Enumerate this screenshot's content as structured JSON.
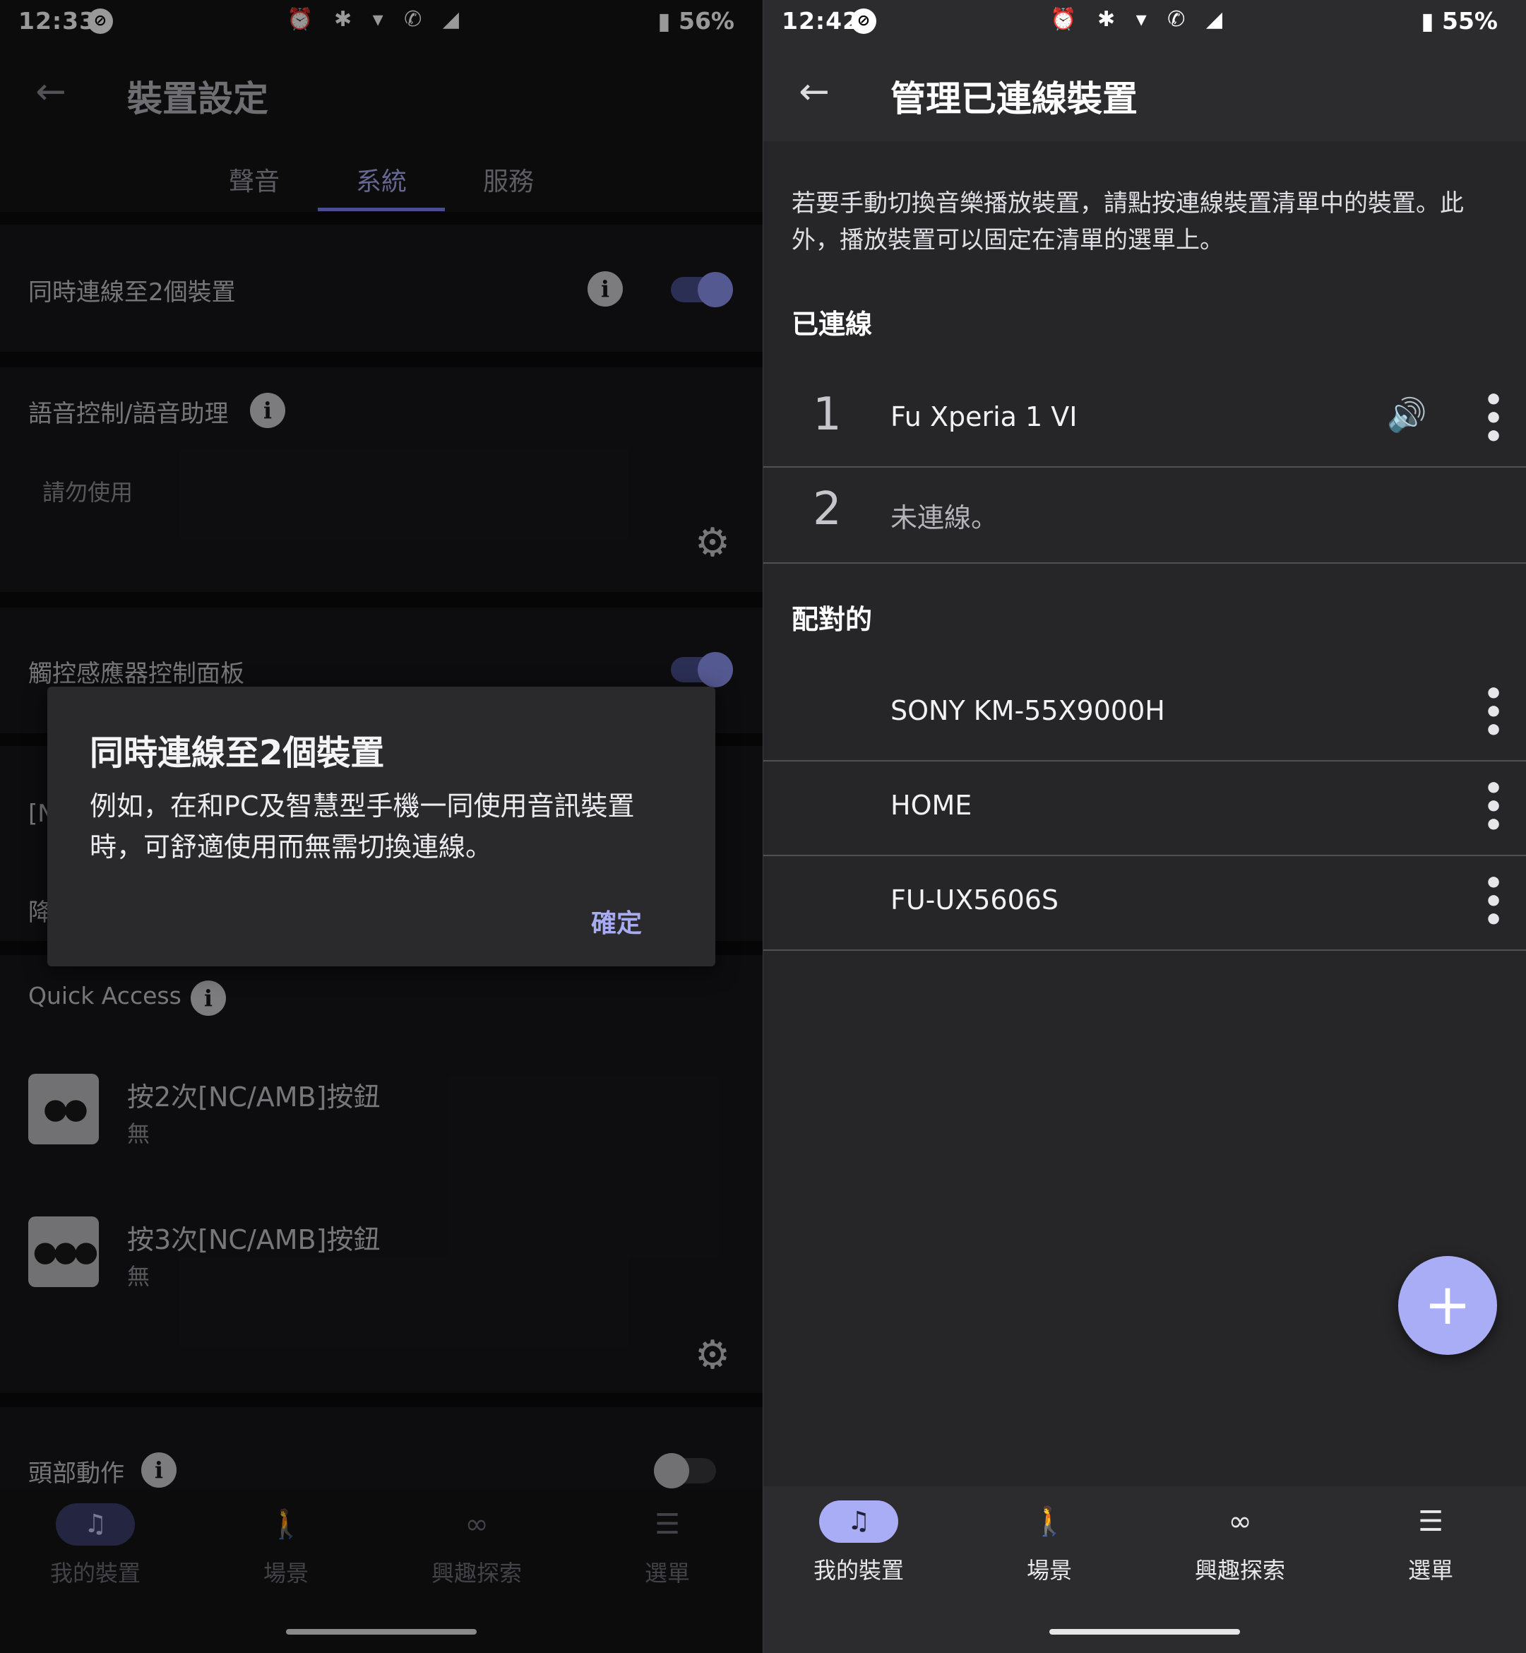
{
  "left": {
    "status": {
      "time": "12:33",
      "icons": "⏰ ✱ ▾ ✆ ◢",
      "battery": "56%"
    },
    "title": "裝置設定",
    "tabs": [
      "聲音",
      "系統",
      "服務"
    ],
    "active_tab": "系統",
    "settings": {
      "dual_connect": {
        "label": "同時連線至2個裝置",
        "on": true
      },
      "voice": {
        "label": "語音控制/語音助理",
        "value": "請勿使用"
      },
      "touch_panel": {
        "label": "觸控感應器控制面板",
        "on": true
      },
      "peek_label_1": "[N",
      "peek_label_2": "降",
      "quick_access": {
        "label": "Quick Access"
      },
      "double_press": {
        "label": "按2次[NC/AMB]按鈕",
        "value": "無",
        "icon": "●●"
      },
      "triple_press": {
        "label": "按3次[NC/AMB]按鈕",
        "value": "無",
        "icon": "●●●"
      },
      "head_gesture": {
        "label": "頭部動作",
        "on": false
      }
    },
    "dialog": {
      "title": "同時連線至2個裝置",
      "body": "例如，在和PC及智慧型手機一同使用音訊裝置時，可舒適使用而無需切換連線。",
      "ok": "確定"
    }
  },
  "right": {
    "status": {
      "time": "12:42",
      "icons": "⏰ ✱ ▾ ✆ ◢",
      "battery": "55%"
    },
    "title": "管理已連線裝置",
    "description": "若要手動切換音樂播放裝置，請點按連線裝置清單中的裝置。此外，播放裝置可以固定在清單的選單上。",
    "connected_header": "已連線",
    "connected": [
      {
        "slot": "1",
        "name": "Fu Xperia 1 VI",
        "playing": true
      },
      {
        "slot": "2",
        "name": "未連線。",
        "playing": false
      }
    ],
    "paired_header": "配對的",
    "paired": [
      "SONY KM-55X9000H",
      "HOME",
      "FU-UX5606S"
    ],
    "fab": "+"
  },
  "nav": {
    "items": [
      {
        "label": "我的裝置",
        "icon": "headphones-speaker-icon",
        "glyph": "♫"
      },
      {
        "label": "場景",
        "icon": "walking-person-icon",
        "glyph": "🚶"
      },
      {
        "label": "興趣探索",
        "icon": "binoculars-icon",
        "glyph": "∞"
      },
      {
        "label": "選單",
        "icon": "menu-icon",
        "glyph": "☰"
      }
    ]
  },
  "colors": {
    "accent": "#a9adf6",
    "accent_dim": "#4a4f8c",
    "bg_left": "#141416",
    "bg_right": "#262628"
  }
}
